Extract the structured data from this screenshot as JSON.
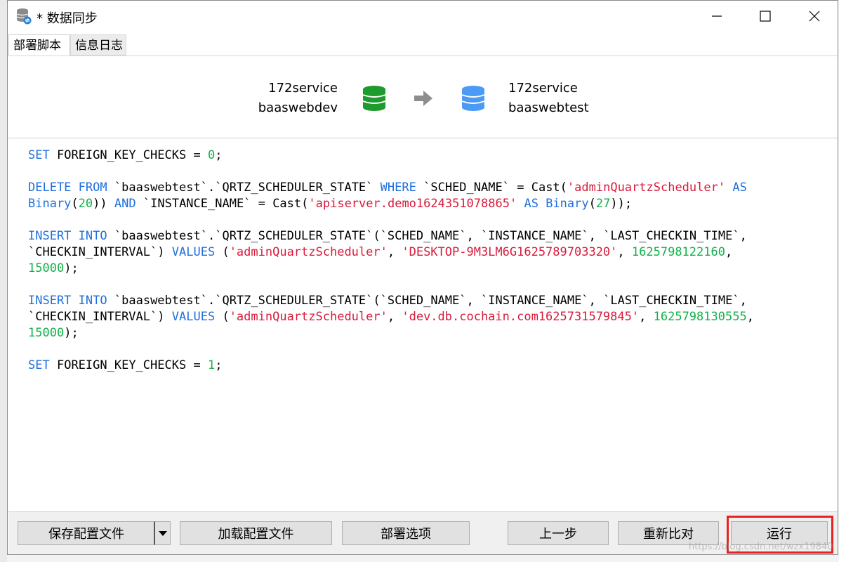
{
  "window": {
    "title": "* 数据同步",
    "minimize_icon": "minimize-icon",
    "maximize_icon": "maximize-icon",
    "close_icon": "close-icon"
  },
  "tabs": [
    {
      "label": "部署脚本",
      "active": true
    },
    {
      "label": "信息日志",
      "active": false
    }
  ],
  "source": {
    "connection": "172service",
    "database": "baaswebdev",
    "icon": "database-icon",
    "color": "#1e9b2c"
  },
  "target": {
    "connection": "172service",
    "database": "baaswebtest",
    "icon": "database-icon",
    "color": "#4b9bf5"
  },
  "arrow_icon": "arrow-right-icon",
  "script": [
    "SET FOREIGN_KEY_CHECKS = 0;",
    "DELETE FROM `baaswebtest`.`QRTZ_SCHEDULER_STATE` WHERE `SCHED_NAME` = Cast('adminQuartzScheduler' AS Binary(20)) AND `INSTANCE_NAME` = Cast('apiserver.demo1624351078865' AS Binary(27));",
    "INSERT INTO `baaswebtest`.`QRTZ_SCHEDULER_STATE`(`SCHED_NAME`, `INSTANCE_NAME`, `LAST_CHECKIN_TIME`, `CHECKIN_INTERVAL`) VALUES ('adminQuartzScheduler', 'DESKTOP-9M3LM6G1625789703320', 1625798122160, 15000);",
    "INSERT INTO `baaswebtest`.`QRTZ_SCHEDULER_STATE`(`SCHED_NAME`, `INSTANCE_NAME`, `LAST_CHECKIN_TIME`, `CHECKIN_INTERVAL`) VALUES ('adminQuartzScheduler', 'dev.db.cochain.com1625731579845', 1625798130555, 15000);",
    "SET FOREIGN_KEY_CHECKS = 1;"
  ],
  "colors": {
    "keyword": "#1f6fdc",
    "string": "#d81b3b",
    "number": "#12b14a",
    "highlight": "#e8231f"
  },
  "footer": {
    "save_config": "保存配置文件",
    "load_config": "加载配置文件",
    "deploy_options": "部署选项",
    "prev_step": "上一步",
    "recompare": "重新比对",
    "run": "运行"
  },
  "watermark": "https://blog.csdn.net/wzx19840"
}
